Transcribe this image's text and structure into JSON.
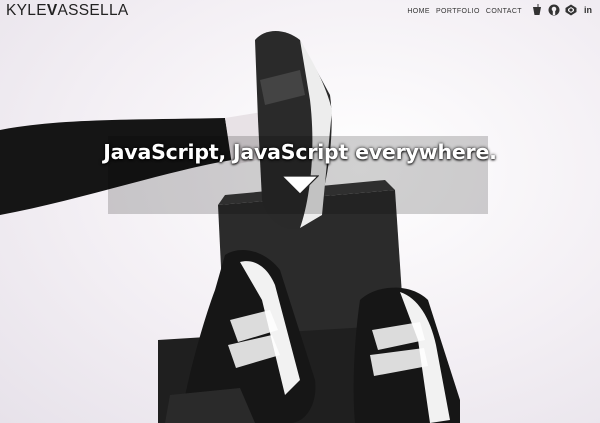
{
  "header": {
    "logo_light_1": "KYLE",
    "logo_bold": "V",
    "logo_light_2": "ASSELLA"
  },
  "nav": [
    {
      "label": "HOME"
    },
    {
      "label": "PORTFOLIO"
    },
    {
      "label": "CONTACT"
    }
  ],
  "social": [
    {
      "icon": "gulp-cup-icon"
    },
    {
      "icon": "github-icon"
    },
    {
      "icon": "codepen-icon"
    },
    {
      "icon": "linkedin-icon",
      "label": "in"
    }
  ],
  "hero": {
    "headline": "JavaScript, JavaScript everywhere."
  },
  "colors": {
    "background": "#f3f0f3",
    "text_dark": "#222222",
    "headline": "#ffffff",
    "box": "#2a2a2a"
  }
}
